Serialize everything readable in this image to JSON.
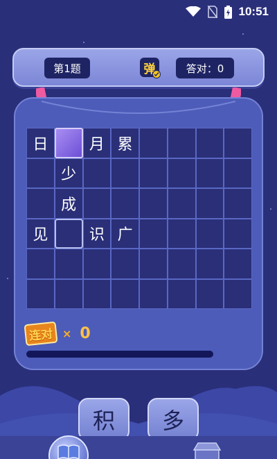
{
  "status": {
    "time": "10:51"
  },
  "header": {
    "question": "第1题",
    "bullet_char": "弹",
    "score_text": "答对：0"
  },
  "board": {
    "rows": [
      [
        "日",
        "",
        "月",
        "累",
        "",
        "",
        "",
        ""
      ],
      [
        "",
        "少",
        "",
        "",
        "",
        "",
        "",
        ""
      ],
      [
        "",
        "成",
        "",
        "",
        "",
        "",
        "",
        ""
      ],
      [
        "见",
        "",
        "识",
        "广",
        "",
        "",
        "",
        ""
      ],
      [
        "",
        "",
        "",
        "",
        "",
        "",
        "",
        ""
      ],
      [
        "",
        "",
        "",
        "",
        "",
        "",
        "",
        ""
      ]
    ]
  },
  "combo": {
    "label": "连对",
    "times": "×",
    "count": "0"
  },
  "progress": {
    "fraction": 0
  },
  "choices": [
    "积",
    "多"
  ],
  "colors": {
    "background": "#2a2f7a",
    "board": "#4d5cb8",
    "accent": "#ffd34d",
    "active_cell": "#8a6ee8"
  }
}
